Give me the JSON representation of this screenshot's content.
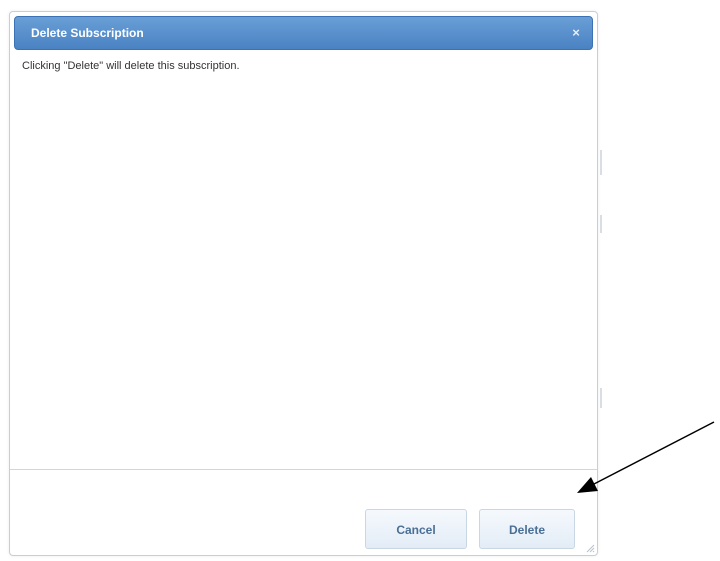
{
  "dialog": {
    "title": "Delete Subscription",
    "close_icon": "close-icon",
    "message": "Clicking \"Delete\" will delete this subscription.",
    "buttons": {
      "cancel_label": "Cancel",
      "delete_label": "Delete"
    }
  },
  "colors": {
    "titlebar": "#4a82c3",
    "button_text": "#4a6f96",
    "arrow": "#000000"
  }
}
